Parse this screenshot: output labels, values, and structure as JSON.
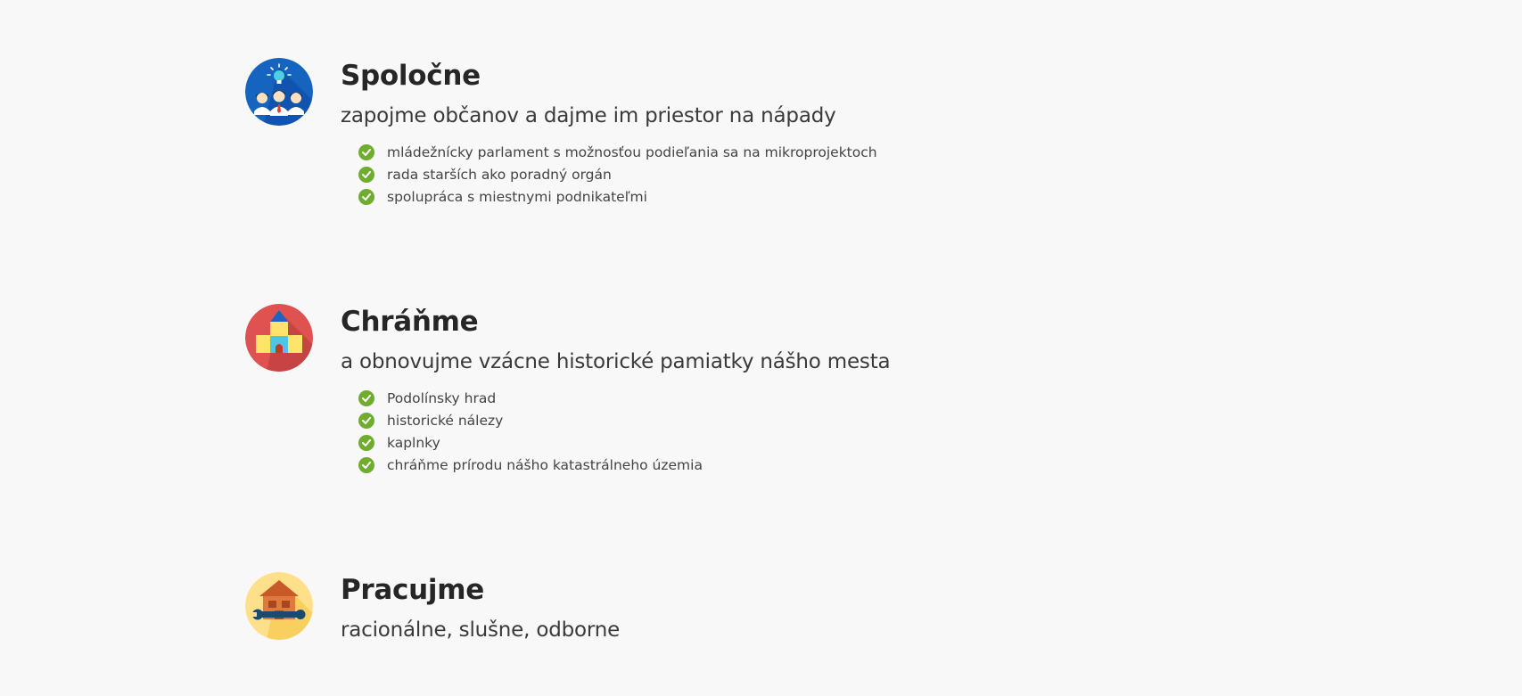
{
  "sections": [
    {
      "icon": "people-idea-icon",
      "title": "Spoločne",
      "subtitle": "zapojme občanov a dajme im priestor na nápady",
      "items": [
        "mládežnícky parlament s možnosťou podieľania sa na mikroprojektoch",
        "rada starších ako poradný orgán",
        "spolupráca s miestnymi podnikateľmi"
      ]
    },
    {
      "icon": "castle-icon",
      "title": "Chráňme",
      "subtitle": "a obnovujme vzácne historické pamiatky nášho mesta",
      "items": [
        "Podolínsky hrad",
        "historické nálezy",
        "kaplnky",
        "chráňme prírodu nášho katastrálneho územia"
      ]
    },
    {
      "icon": "house-wrench-icon",
      "title": "Pracujme",
      "subtitle": "racionálne, slušne, odborne",
      "items": []
    }
  ],
  "colors": {
    "background": "#f8f8f8",
    "check": "#6fac2f",
    "icon_blue": "#1565c0",
    "icon_red": "#e05252",
    "icon_yellow": "#ffe08a"
  }
}
